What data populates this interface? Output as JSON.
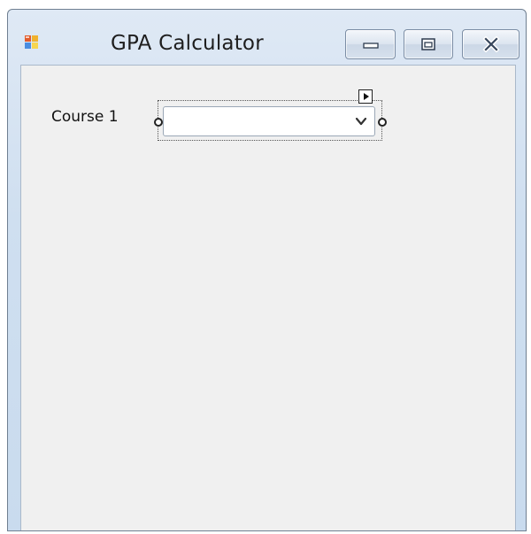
{
  "window": {
    "title": "GPA Calculator",
    "icons": {
      "app": "windows-form-icon",
      "minimize": "minimize-icon",
      "maximize": "maximize-icon",
      "close": "close-icon"
    }
  },
  "form": {
    "label": "Course 1",
    "combo": {
      "value": "",
      "arrow_icon": "chevron-down-icon"
    },
    "smart_tag_icon": "smart-tag-arrow-icon"
  },
  "colors": {
    "title_bar": "#cfdff0",
    "client_bg": "#f0f0f0",
    "border": "#6f7f91"
  }
}
